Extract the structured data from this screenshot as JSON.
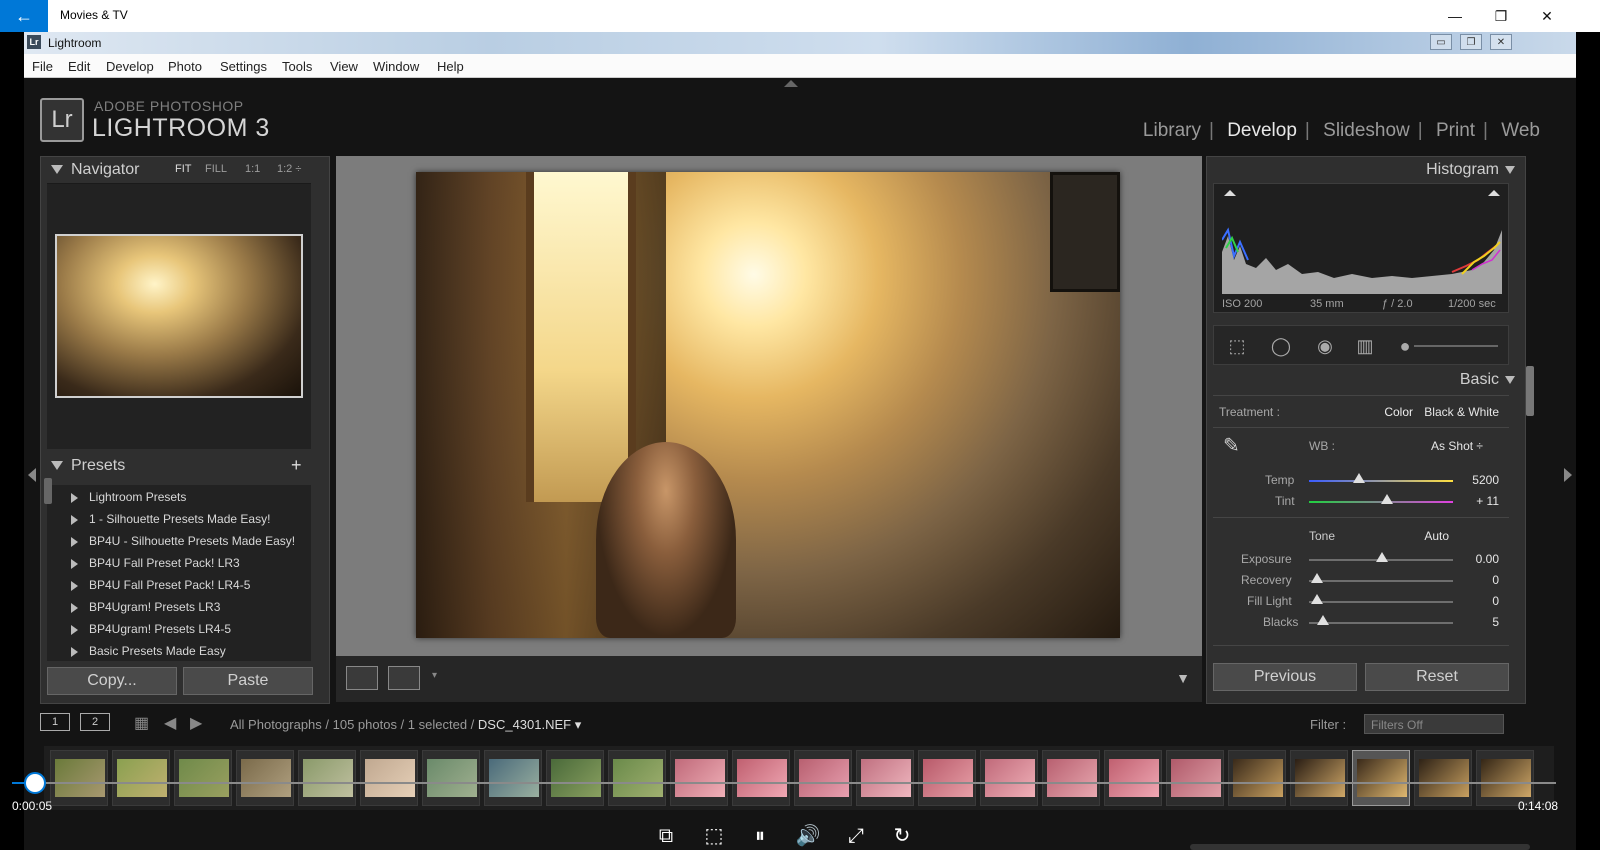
{
  "app": {
    "title": "Movies & TV",
    "back_icon": "back-arrow-icon",
    "minimize_icon": "minimize-icon",
    "restore_icon": "restore-icon",
    "close_icon": "close-icon"
  },
  "lightroom": {
    "window_title": "Lightroom",
    "menu": [
      "File",
      "Edit",
      "Develop",
      "Photo",
      "Settings",
      "Tools",
      "View",
      "Window",
      "Help"
    ],
    "brand_line1": "ADOBE PHOTOSHOP",
    "brand_line2": "LIGHTROOM 3",
    "logo_text": "Lr",
    "modules": [
      "Library",
      "Develop",
      "Slideshow",
      "Print",
      "Web"
    ],
    "active_module": "Develop",
    "navigator": {
      "title": "Navigator",
      "zoom_options": [
        "FIT",
        "FILL",
        "1:1",
        "1:2 ÷"
      ]
    },
    "presets": {
      "title": "Presets",
      "add_label": "+",
      "items": [
        "Lightroom Presets",
        "1 - Silhouette Presets Made Easy!",
        "BP4U - Silhouette Presets Made Easy!",
        "BP4U Fall Preset Pack! LR3",
        "BP4U Fall Preset Pack! LR4-5",
        "BP4Ugram! Presets LR3",
        "BP4Ugram! Presets LR4-5",
        "Basic Presets Made Easy"
      ]
    },
    "left_buttons": {
      "copy": "Copy...",
      "paste": "Paste"
    },
    "histogram": {
      "title": "Histogram",
      "iso": "ISO 200",
      "focal": "35 mm",
      "aperture": "ƒ / 2.0",
      "shutter": "1/200 sec"
    },
    "basic": {
      "title": "Basic",
      "treatment_label": "Treatment :",
      "treatment_color": "Color",
      "treatment_bw": "Black & White",
      "wb_label": "WB :",
      "wb_value": "As Shot ÷",
      "temp_label": "Temp",
      "temp_value": "5200",
      "tint_label": "Tint",
      "tint_value": "+ 11",
      "tone_label": "Tone",
      "tone_auto": "Auto",
      "exposure_label": "Exposure",
      "exposure_value": "0.00",
      "recovery_label": "Recovery",
      "recovery_value": "0",
      "filllight_label": "Fill Light",
      "filllight_value": "0",
      "blacks_label": "Blacks",
      "blacks_value": "5"
    },
    "right_buttons": {
      "previous": "Previous",
      "reset": "Reset"
    },
    "filmstrip": {
      "screen1": "1",
      "screen2": "2",
      "path": "All Photographs / 105 photos / 1 selected / ",
      "filename": "DSC_4301.NEF ▾",
      "filter_label": "Filter :",
      "filter_value": "Filters Off"
    }
  },
  "player": {
    "elapsed": "0:00:05",
    "total": "0:14:08",
    "progress": 0.006
  },
  "colors": {
    "accent": "#0078d7",
    "lr_background": "#141414",
    "panel": "#2f2f2f"
  }
}
